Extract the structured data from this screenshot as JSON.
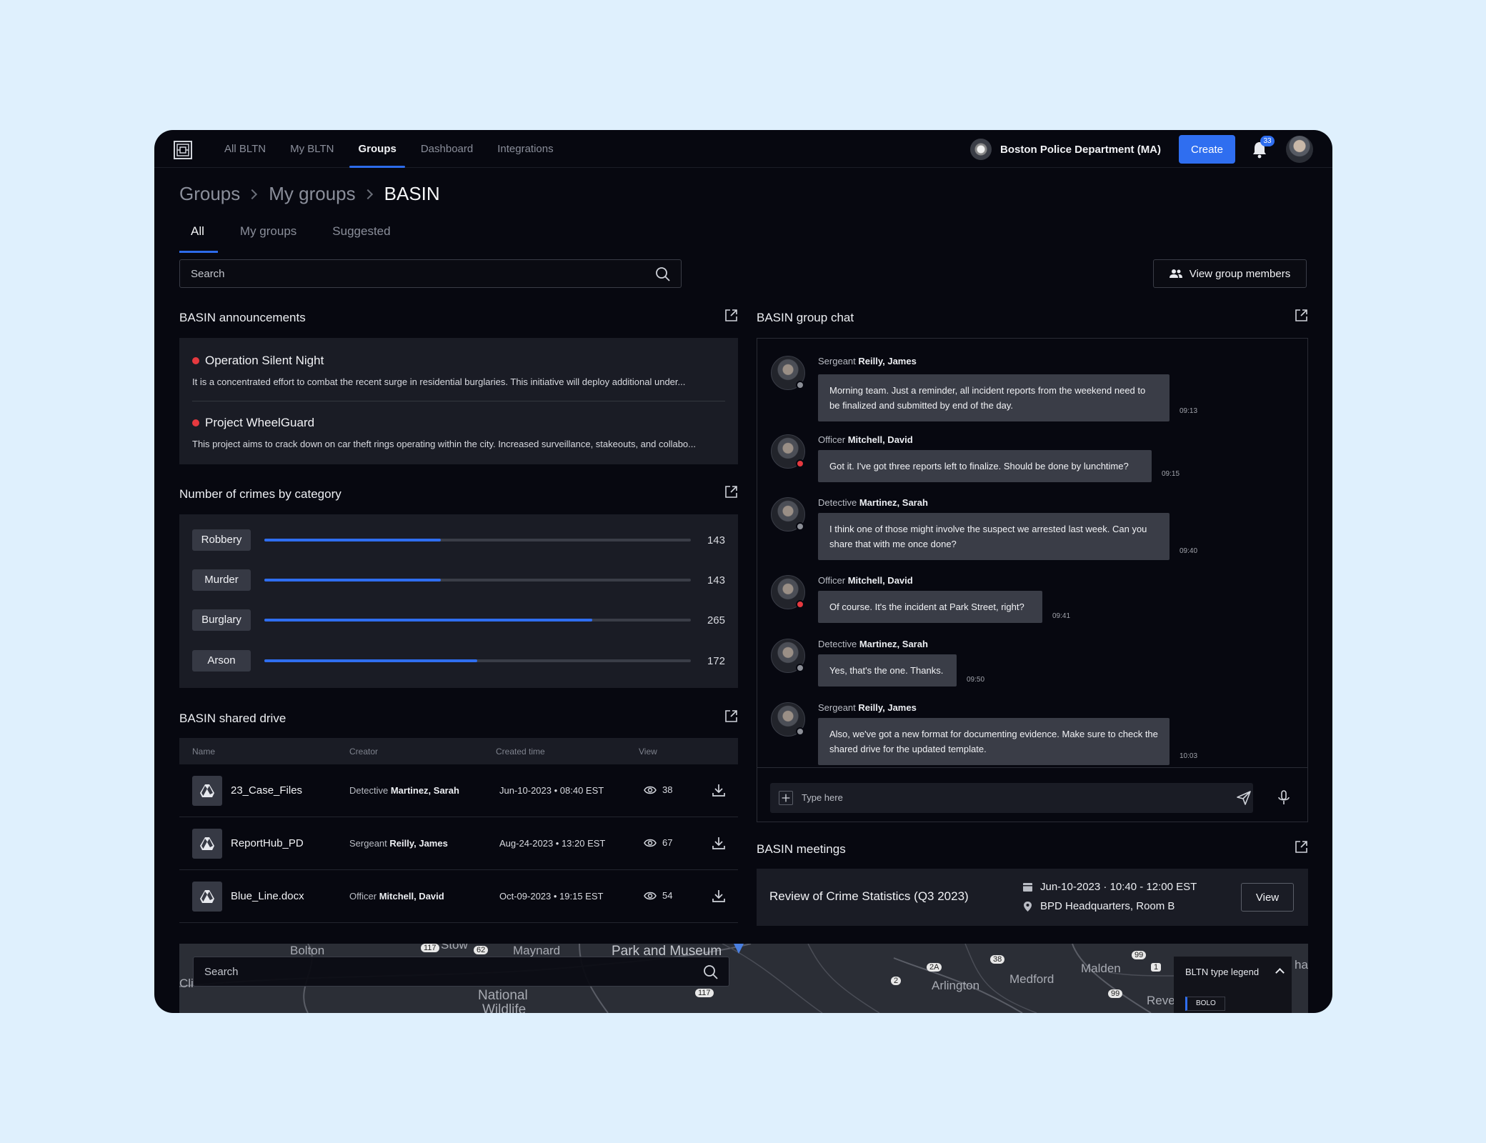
{
  "nav": {
    "items": [
      {
        "label": "All BLTN"
      },
      {
        "label": "My BLTN"
      },
      {
        "label": "Groups",
        "active": true
      },
      {
        "label": "Dashboard"
      },
      {
        "label": "Integrations"
      }
    ],
    "department": "Boston Police Department (MA)",
    "create_label": "Create",
    "notification_count": "33"
  },
  "breadcrumb": {
    "items": [
      "Groups",
      "My groups",
      "BASIN"
    ]
  },
  "tabs": [
    {
      "label": "All",
      "active": true
    },
    {
      "label": "My groups"
    },
    {
      "label": "Suggested"
    }
  ],
  "search": {
    "placeholder": "Search"
  },
  "view_members_label": "View group members",
  "announcements": {
    "title": "BASIN announcements",
    "items": [
      {
        "title": "Operation Silent Night",
        "body": "It is a concentrated effort to combat the recent surge in residential burglaries. This initiative will deploy additional under..."
      },
      {
        "title": "Project WheelGuard",
        "body": "This project aims to crack down on car theft rings operating within the city. Increased surveillance, stakeouts, and collabo..."
      }
    ]
  },
  "crimes": {
    "title": "Number of crimes by category",
    "max": 345,
    "items": [
      {
        "label": "Robbery",
        "value": 143,
        "value_text": "143"
      },
      {
        "label": "Murder",
        "value": 143,
        "value_text": "143"
      },
      {
        "label": "Burglary",
        "value": 265,
        "value_text": "265"
      },
      {
        "label": "Arson",
        "value": 172,
        "value_text": "172"
      }
    ]
  },
  "drive": {
    "title": "BASIN shared drive",
    "columns": [
      "Name",
      "Creator",
      "Created time",
      "View"
    ],
    "rows": [
      {
        "name": "23_Case_Files",
        "creator_role": "Detective",
        "creator_name": "Martinez, Sarah",
        "time": "Jun-10-2023 • 08:40 EST",
        "views": "38"
      },
      {
        "name": "ReportHub_PD",
        "creator_role": "Sergeant",
        "creator_name": "Reilly, James",
        "time": "Aug-24-2023 • 13:20 EST",
        "views": "67"
      },
      {
        "name": "Blue_Line.docx",
        "creator_role": "Officer",
        "creator_name": "Mitchell, David",
        "time": "Oct-09-2023 • 19:15 EST",
        "views": "54"
      }
    ]
  },
  "chat": {
    "title": "BASIN group chat",
    "messages": [
      {
        "role": "Sergeant",
        "name": "Reilly, James",
        "text": "Morning team. Just a reminder, all incident reports from the weekend need to be finalized and submitted by end of the day.",
        "time": "09:13",
        "status": "grey"
      },
      {
        "role": "Officer",
        "name": "Mitchell, David",
        "text": "Got it. I've got three reports left to finalize. Should be done by lunchtime?",
        "time": "09:15",
        "status": "red"
      },
      {
        "role": "Detective",
        "name": "Martinez, Sarah",
        "text": "I think one of those might involve the suspect we arrested last week. Can you share that with me once done?",
        "time": "09:40",
        "status": "grey"
      },
      {
        "role": "Officer",
        "name": "Mitchell, David",
        "text": "Of course. It's the incident at Park Street, right?",
        "time": "09:41",
        "status": "red"
      },
      {
        "role": "Detective",
        "name": "Martinez, Sarah",
        "text": "Yes, that's the one. Thanks.",
        "time": "09:50",
        "status": "grey"
      },
      {
        "role": "Sergeant",
        "name": "Reilly, James",
        "text": "Also, we've got a new format for documenting evidence. Make sure to check the shared drive for the updated template.",
        "time": "10:03",
        "status": "grey"
      }
    ],
    "input_placeholder": "Type here"
  },
  "meetings": {
    "title": "BASIN meetings",
    "items": [
      {
        "title": "Review of Crime Statistics (Q3 2023)",
        "date": "Jun-10-2023",
        "time": "10:40 - 12:00 EST",
        "location": "BPD Headquarters, Room B",
        "view_label": "View"
      }
    ]
  },
  "map": {
    "search_placeholder": "Search",
    "places": [
      "Bolton",
      "Stow",
      "Maynard",
      "Park and Museum",
      "National",
      "Wildlife",
      "Arlington",
      "Medford",
      "Malden",
      "Reve",
      "Cli",
      "har"
    ],
    "route_markers": [
      "117",
      "62",
      "117",
      "2A",
      "38",
      "99",
      "1",
      "2",
      "99"
    ],
    "legend_title": "BLTN type legend",
    "legend_items": [
      "BOLO"
    ]
  },
  "colors": {
    "accent": "#2f6ef0",
    "alert": "#e5393f",
    "background": "#070810",
    "panel": "#1a1c25"
  }
}
